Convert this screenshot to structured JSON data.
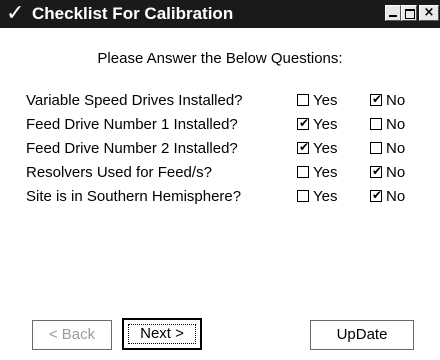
{
  "window": {
    "title": "Checklist For Calibration",
    "title_icon": "check-icon",
    "titlebar_color": "#1a1a1a"
  },
  "heading": "Please Answer the Below Questions:",
  "options": {
    "yes_label": "Yes",
    "no_label": "No"
  },
  "questions": [
    {
      "label": "Variable Speed Drives Installed?",
      "yes": false,
      "no": true
    },
    {
      "label": "Feed Drive Number 1 Installed?",
      "yes": true,
      "no": false
    },
    {
      "label": "Feed Drive Number 2 Installed?",
      "yes": true,
      "no": false
    },
    {
      "label": "Resolvers Used for Feed/s?",
      "yes": false,
      "no": true
    },
    {
      "label": "Site is in Southern Hemisphere?",
      "yes": false,
      "no": true
    }
  ],
  "buttons": {
    "back": "< Back",
    "next": "Next >",
    "update": "UpDate"
  }
}
